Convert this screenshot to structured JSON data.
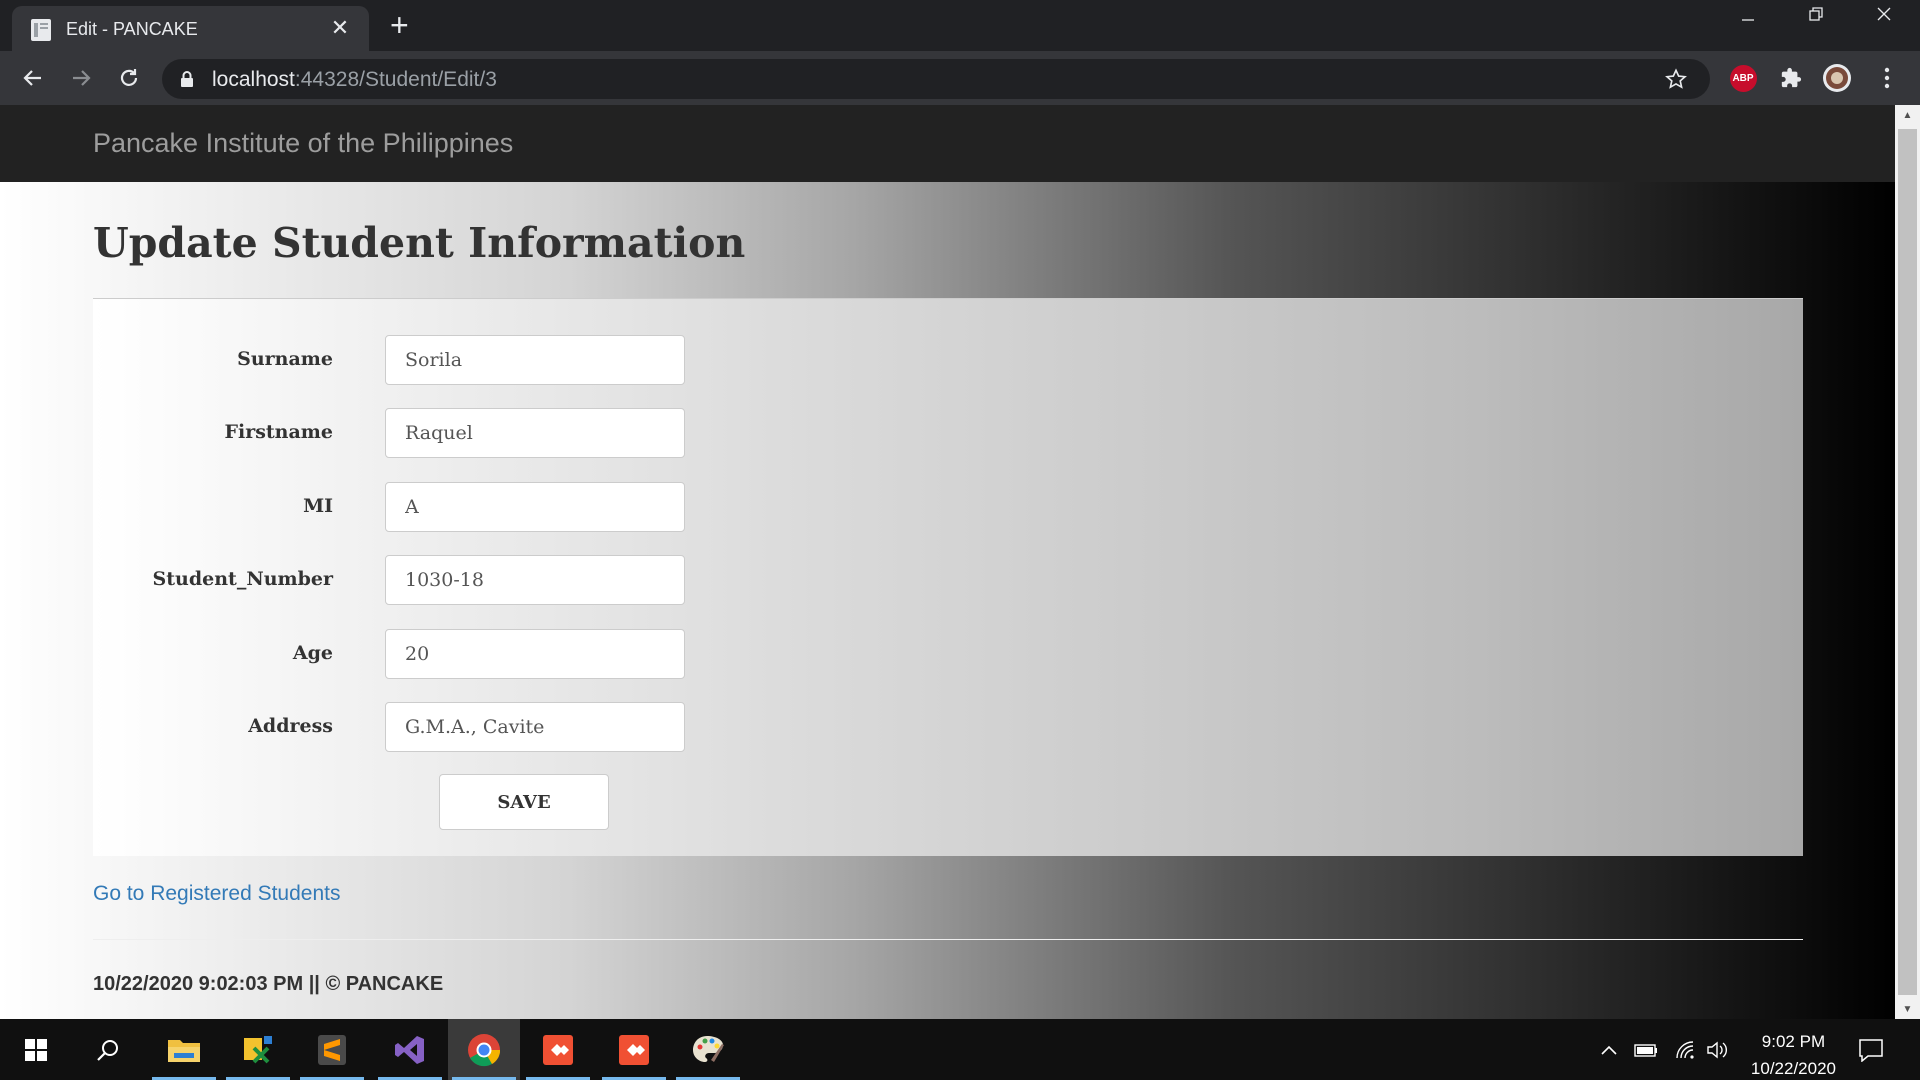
{
  "browser": {
    "tab_title": "Edit - PANCAKE",
    "tab_close": "✕",
    "new_tab": "+",
    "url_host": "localhost",
    "url_rest": ":44328/Student/Edit/3",
    "extension_abp": "ABP"
  },
  "site": {
    "brand": "Pancake Institute of the Philippines"
  },
  "page": {
    "title": "Update Student Information",
    "fields": [
      {
        "label": "Surname",
        "value": "Sorila"
      },
      {
        "label": "Firstname",
        "value": "Raquel"
      },
      {
        "label": "MI",
        "value": "A"
      },
      {
        "label": "Student_Number",
        "value": "1030-18"
      },
      {
        "label": "Age",
        "value": "20"
      },
      {
        "label": "Address",
        "value": "G.M.A., Cavite"
      }
    ],
    "save_label": "SAVE",
    "back_link": "Go to Registered Students",
    "footer": "10/22/2020 9:02:03 PM || © PANCAKE"
  },
  "taskbar": {
    "time": "9:02 PM",
    "date": "10/22/2020",
    "apps": [
      "windows-start",
      "search",
      "file-explorer",
      "excel-like-app",
      "sublime-text",
      "visual-studio",
      "chrome",
      "git-app-1",
      "git-app-2",
      "paint-app"
    ]
  },
  "colors": {
    "navbar_bg": "#222222",
    "link": "#337ab7",
    "chrome_dark": "#202124",
    "chrome_toolbar": "#35363a"
  }
}
